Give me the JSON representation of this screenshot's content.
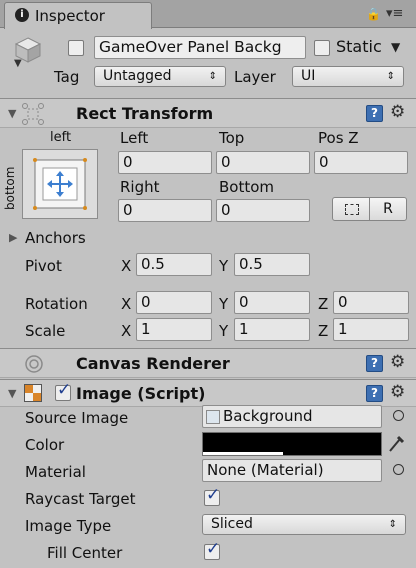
{
  "tab": {
    "title": "Inspector"
  },
  "gameobject": {
    "name": "GameOver Panel Backg",
    "static_label": "Static",
    "tag_label": "Tag",
    "tag_value": "Untagged",
    "layer_label": "Layer",
    "layer_value": "UI"
  },
  "rect_transform": {
    "title": "Rect Transform",
    "anchor_top_label": "left",
    "anchor_side_label": "bottom",
    "left_label": "Left",
    "top_label": "Top",
    "posz_label": "Pos Z",
    "left_value": "0",
    "top_value": "0",
    "posz_value": "0",
    "right_label": "Right",
    "bottom_label": "Bottom",
    "right_value": "0",
    "bottom_value": "0",
    "r_button": "R",
    "anchors_label": "Anchors",
    "pivot_label": "Pivot",
    "pivot_x": "0.5",
    "pivot_y": "0.5",
    "rotation_label": "Rotation",
    "rot_x": "0",
    "rot_y": "0",
    "rot_z": "0",
    "scale_label": "Scale",
    "scale_x": "1",
    "scale_y": "1",
    "scale_z": "1",
    "x": "X",
    "y": "Y",
    "z": "Z"
  },
  "canvas_renderer": {
    "title": "Canvas Renderer"
  },
  "image": {
    "title": "Image (Script)",
    "source_image_label": "Source Image",
    "source_image_value": "Background",
    "color_label": "Color",
    "color_value": "#000000",
    "alpha_fraction": 0.45,
    "material_label": "Material",
    "material_value": "None (Material)",
    "raycast_label": "Raycast Target",
    "raycast_checked": true,
    "image_type_label": "Image Type",
    "image_type_value": "Sliced",
    "fill_center_label": "Fill Center",
    "fill_center_checked": true
  },
  "colors": {
    "accent": "#3d6fb2",
    "background": "#c2c2c2"
  }
}
